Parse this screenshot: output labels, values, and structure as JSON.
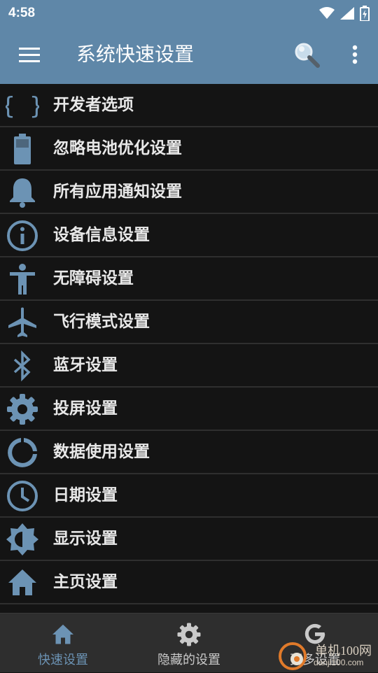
{
  "status_bar": {
    "time": "4:58",
    "icons": [
      "wifi-icon",
      "signal-icon",
      "battery-charging-icon"
    ]
  },
  "app_bar": {
    "title": "系统快速设置",
    "icons": [
      "menu-icon",
      "search-icon",
      "more-vert-icon"
    ]
  },
  "colors": {
    "app_bar": "#5f87a8",
    "icon": "#6c93b4",
    "background": "#141414",
    "nav_active": "#6c93b4",
    "nav_inactive": "#c9c9c9"
  },
  "items": [
    {
      "label": "开发者选项",
      "icon": "braces-icon"
    },
    {
      "label": "忽略电池优化设置",
      "icon": "battery-icon"
    },
    {
      "label": "所有应用通知设置",
      "icon": "bell-icon"
    },
    {
      "label": "设备信息设置",
      "icon": "info-icon"
    },
    {
      "label": "无障碍设置",
      "icon": "accessibility-icon"
    },
    {
      "label": "飞行模式设置",
      "icon": "airplane-icon"
    },
    {
      "label": "蓝牙设置",
      "icon": "bluetooth-icon"
    },
    {
      "label": "投屏设置",
      "icon": "gear-icon"
    },
    {
      "label": "数据使用设置",
      "icon": "data-usage-icon"
    },
    {
      "label": "日期设置",
      "icon": "clock-icon"
    },
    {
      "label": "显示设置",
      "icon": "brightness-icon"
    },
    {
      "label": "主页设置",
      "icon": "home-icon"
    }
  ],
  "bottom_nav": [
    {
      "label": "快速设置",
      "icon": "home-icon",
      "active": true
    },
    {
      "label": "隐藏的设置",
      "icon": "gear-icon",
      "active": false
    },
    {
      "label": "更多设置",
      "icon": "google-icon",
      "active": false
    }
  ],
  "watermark": {
    "text": "单机100网",
    "url": "danji100.com"
  }
}
